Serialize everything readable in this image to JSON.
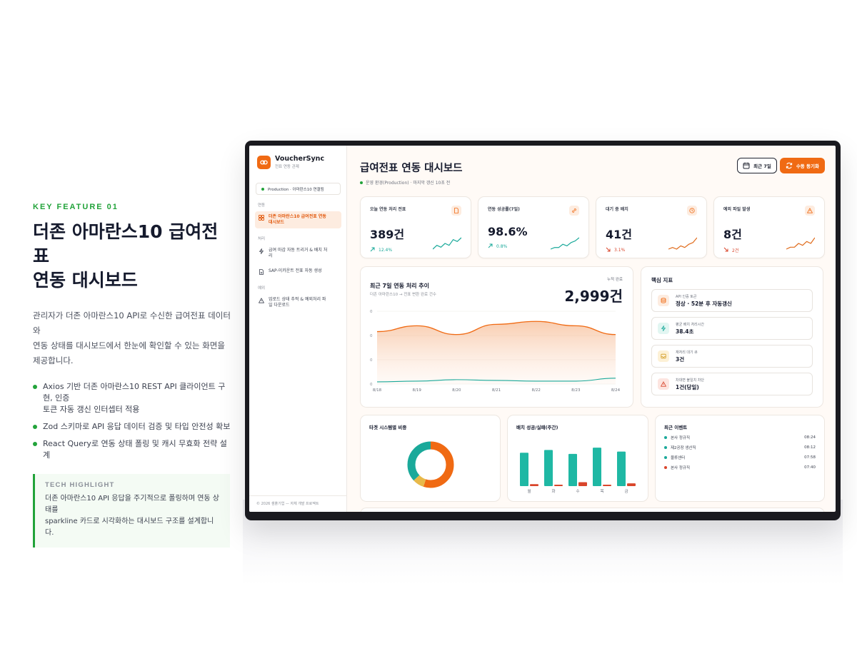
{
  "feature": {
    "label": "KEY FEATURE 01",
    "title_line1": "더존 아마란스10 급여전표",
    "title_line2": "연동 대시보드",
    "desc_line1": "관리자가 더존 아마란스10 API로 수신한 급여전표 데이터와",
    "desc_line2": "연동 상태를 대시보드에서 한눈에 확인할 수 있는 화면을",
    "desc_line3": "제공합니다.",
    "bullets": [
      {
        "line1": "Axios 기반 더존 아마란스10 REST API 클라이언트 구현, 인증",
        "line2": "토큰 자동 갱신 인터셉터 적용"
      },
      {
        "line1": "Zod 스키마로 API 응답 데이터 검증 및 타입 안전성 확보",
        "line2": ""
      },
      {
        "line1": "React Query로 연동 상태 폴링 및 캐시 무효화 전략 설계",
        "line2": ""
      }
    ],
    "tech_label": "TECH HIGHLIGHT",
    "tech_line1": "더존 아마란스10 API 응답을 주기적으로 폴링하며 연동 상태를",
    "tech_line2": "sparkline 카드로 시각화하는 대시보드 구조를 설계합니다."
  },
  "app": {
    "brand": "VoucherSync",
    "brand_sub": "전표 연동 관제",
    "env": "Production · 아마란스10 연결됨",
    "sections": {
      "s1": "연동",
      "s2": "처리",
      "s3": "예외"
    },
    "nav": {
      "dashboard_l1": "더존 아마란스10 급여전표 연동",
      "dashboard_l2": "대시보드",
      "trigger_l1": "급여 마감 자동 트리거 & 배치 처",
      "trigger_l2": "리",
      "sap": "SAP-이카운트 전표 자동 생성",
      "upload_l1": "업로드 상태 추적 & 예외처리 파",
      "upload_l2": "일 다운로드"
    },
    "footer": "© 2026 샘플기업 — 자체 개발 프로젝트"
  },
  "header": {
    "title": "급여전표 연동 대시보드",
    "sub": "운영 환경(Production) · 마지막 갱신 10초 전",
    "range_btn": "최근 7일",
    "sync_btn": "수동 동기화"
  },
  "kpis": [
    {
      "label": "오늘 연동 처리 전표",
      "value": "389건",
      "delta": "12.4%",
      "dir": "up",
      "color": "#1aa99a",
      "spark": [
        2,
        4,
        3,
        5,
        4,
        7,
        6,
        8
      ]
    },
    {
      "label": "연동 성공률(7일)",
      "value": "98.6%",
      "delta": "0.8%",
      "dir": "up",
      "color": "#1aa99a",
      "spark": [
        1,
        2,
        2,
        4,
        3,
        5,
        6,
        8
      ]
    },
    {
      "label": "대기 중 배치",
      "value": "41건",
      "delta": "3.1%",
      "dir": "down",
      "color": "#d9452b",
      "spark": [
        1,
        2,
        1,
        3,
        2,
        4,
        5,
        8
      ]
    },
    {
      "label": "예외 파일 발생",
      "value": "8건",
      "delta": "2건",
      "dir": "down",
      "color": "#d9452b",
      "spark": [
        2,
        3,
        3,
        5,
        4,
        6,
        5,
        8
      ]
    }
  ],
  "colors": {
    "accent": "#f06a13",
    "green": "#22a33a",
    "teal": "#1aa99a",
    "red": "#d9452b",
    "yellow": "#e8b94a"
  },
  "trend": {
    "title": "최근 7일 연동 처리 추이",
    "sub": "더존 아마란스10 → 전표 변환 완료 건수",
    "total_label": "누적 완료",
    "total": "2,999건"
  },
  "chart_data": {
    "type": "area",
    "x": [
      "8/18",
      "8/19",
      "8/20",
      "8/21",
      "8/22",
      "8/23",
      "8/24"
    ],
    "y_ticks": [
      "0",
      "0",
      "0",
      "0"
    ],
    "series": [
      {
        "values": [
          0.72,
          0.8,
          0.68,
          0.82,
          0.86,
          0.8,
          0.68
        ],
        "color": "#f06a13"
      },
      {
        "values": [
          0.03,
          0.04,
          0.06,
          0.05,
          0.04,
          0.04,
          0.08
        ],
        "color": "#1aa99a"
      }
    ]
  },
  "core": {
    "title": "핵심 지표",
    "items": [
      {
        "label": "API 인증 토큰",
        "value": "정상 · 52분 후 자동갱신",
        "icon": "database-icon",
        "bg": "#fdece0",
        "fg": "#f06a13"
      },
      {
        "label": "평균 배치 처리시간",
        "value": "38.4초",
        "icon": "bolt-icon",
        "bg": "#e2f6f2",
        "fg": "#1aa99a"
      },
      {
        "label": "재처리 대기 큐",
        "value": "3건",
        "icon": "inbox-icon",
        "bg": "#fdf1d6",
        "fg": "#d39b22"
      },
      {
        "label": "차대변 불일치 차단",
        "value": "1건(당일)",
        "icon": "alert-icon",
        "bg": "#fde5e0",
        "fg": "#d9452b"
      }
    ]
  },
  "donut": {
    "title": "타겟 시스템별 비중",
    "slices": [
      {
        "value": 55,
        "color": "#f06a13"
      },
      {
        "value": 8,
        "color": "#e8b94a"
      },
      {
        "value": 37,
        "color": "#1aa99a"
      }
    ]
  },
  "bars": {
    "title": "배치 성공/실패(주간)",
    "days": [
      "월",
      "화",
      "수",
      "목",
      "금"
    ],
    "success": [
      0.85,
      0.92,
      0.82,
      0.98,
      0.88
    ],
    "fail": [
      0.05,
      0.03,
      0.1,
      0.03,
      0.07
    ]
  },
  "events": {
    "title": "최근 이벤트",
    "items": [
      {
        "name": "본사 정규직",
        "time": "08:24",
        "color": "#1aa99a"
      },
      {
        "name": "제2공장 생산직",
        "time": "08:12",
        "color": "#1aa99a"
      },
      {
        "name": "물류센터",
        "time": "07:58",
        "color": "#1aa99a"
      },
      {
        "name": "본사 정규직",
        "time": "07:40",
        "color": "#d9452b"
      }
    ]
  }
}
